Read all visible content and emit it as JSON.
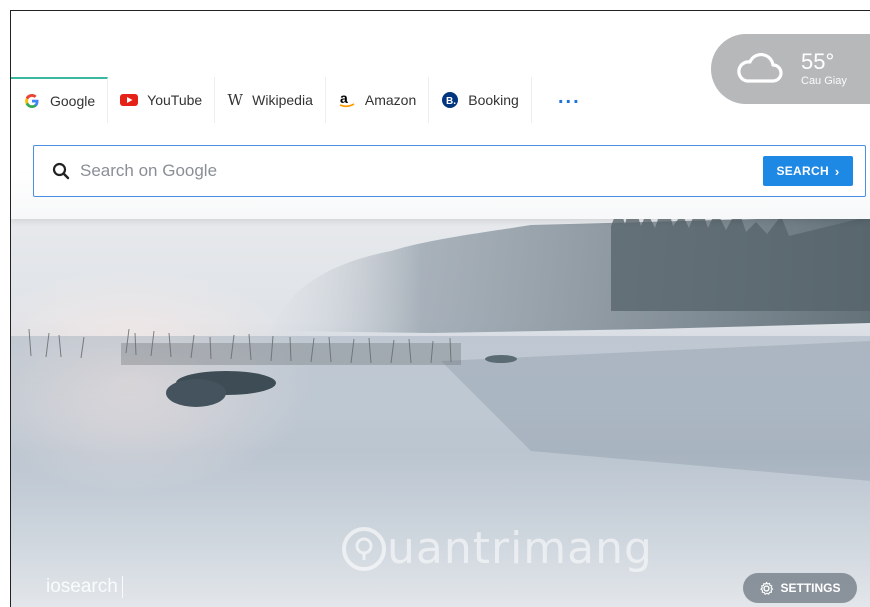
{
  "tabs": [
    {
      "label": "Google",
      "icon": "google-icon",
      "color": "#4285f4",
      "active": true
    },
    {
      "label": "YouTube",
      "icon": "youtube-icon",
      "color": "#e62117",
      "active": false
    },
    {
      "label": "Wikipedia",
      "icon": "wikipedia-icon",
      "color": "#333333",
      "active": false
    },
    {
      "label": "Amazon",
      "icon": "amazon-icon",
      "color": "#000000",
      "active": false
    },
    {
      "label": "Booking",
      "icon": "booking-icon",
      "color": "#003580",
      "active": false
    }
  ],
  "more_label": "...",
  "search": {
    "placeholder": "Search on Google",
    "value": "",
    "button_label": "SEARCH"
  },
  "weather": {
    "temperature": "55°",
    "city": "Cau Giay",
    "icon": "cloud-icon"
  },
  "footer": {
    "brand": "iosearch",
    "settings_label": "SETTINGS",
    "watermark": "uantrimang"
  },
  "colors": {
    "accent": "#1e88e5",
    "active_tab_border": "#3cb7a0",
    "weather_bg": "#b7b8ba"
  }
}
